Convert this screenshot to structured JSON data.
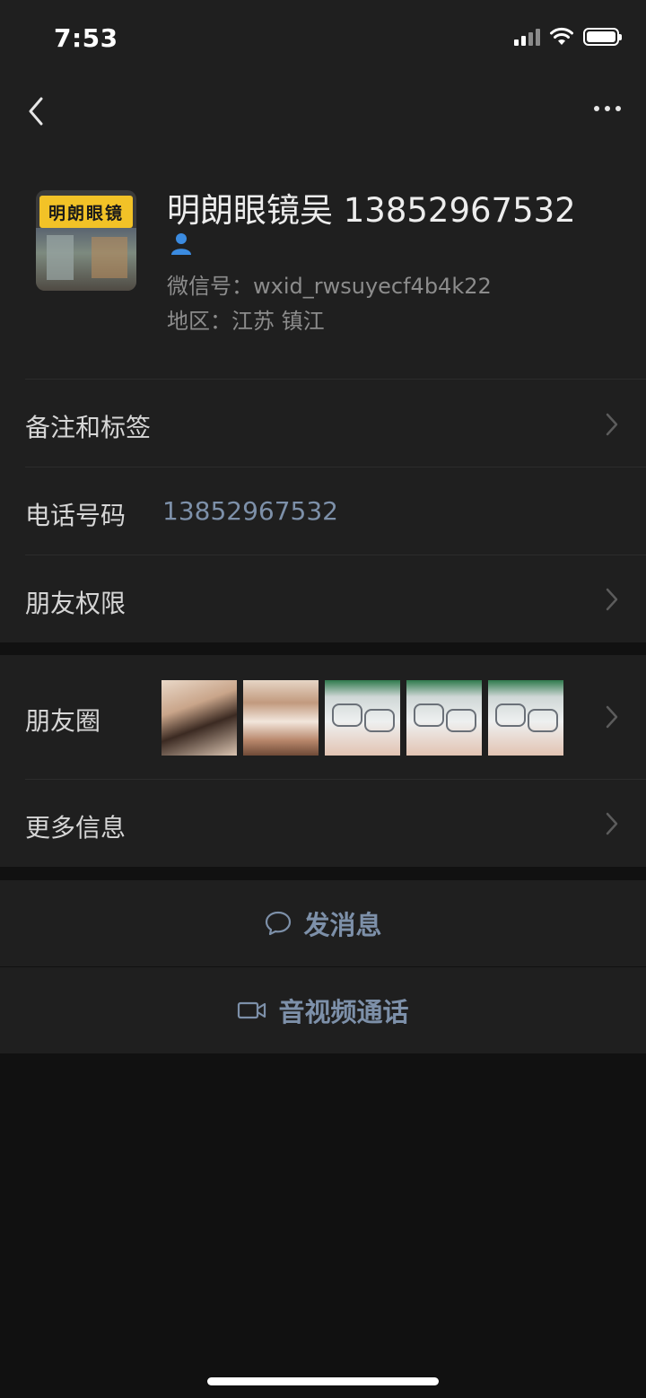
{
  "status_bar": {
    "time": "7:53",
    "signal_icon": "cellular-signal-icon",
    "wifi_icon": "wifi-icon",
    "battery_icon": "battery-icon"
  },
  "nav": {
    "back_icon": "back-chevron-icon",
    "more_icon": "more-dots-icon"
  },
  "profile": {
    "avatar_sign_text": "明朗眼镜",
    "name": "明朗眼镜吴 13852967532",
    "gender_icon": "male-person-icon",
    "wechat_id": "微信号：wxid_rwsuyecf4b4k22",
    "region": "地区：江苏 镇江"
  },
  "cells": {
    "remarks_label": "备注和标签",
    "phone_label": "电话号码",
    "phone_value": "13852967532",
    "permissions_label": "朋友权限",
    "moments_label": "朋友圈",
    "more_info_label": "更多信息"
  },
  "actions": {
    "message_label": "发消息",
    "message_icon": "chat-bubble-icon",
    "call_label": "音视频通话",
    "call_icon": "video-camera-icon"
  },
  "colors": {
    "background": "#111111",
    "cell_background": "#1f1f1f",
    "link_blue": "#7d90a9",
    "secondary_text": "#8c8c8c"
  }
}
